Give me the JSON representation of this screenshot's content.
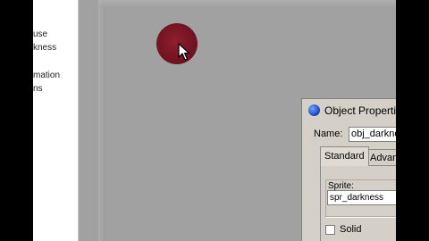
{
  "side_panel": {
    "lines": [
      "use",
      "kness",
      "mation",
      "ns"
    ]
  },
  "dialog": {
    "title": "Object Properties",
    "name_label": "Name:",
    "name_value": "obj_darkness",
    "tabs": [
      {
        "label": "Standard",
        "active": true
      },
      {
        "label": "Advanced",
        "active": false
      }
    ],
    "sprite_label": "Sprite:",
    "sprite_value": "spr_darkness",
    "solid_label": "Solid",
    "solid_checked": false
  },
  "colors": {
    "room_background": "#a1a1a1",
    "blob": "#7a1826",
    "dialog_face": "#d4d0c8"
  },
  "icons": {
    "dialog": "object-globe-icon",
    "sprite_browse": "sprite-browse-icon",
    "pointer": "mouse-pointer-icon"
  }
}
